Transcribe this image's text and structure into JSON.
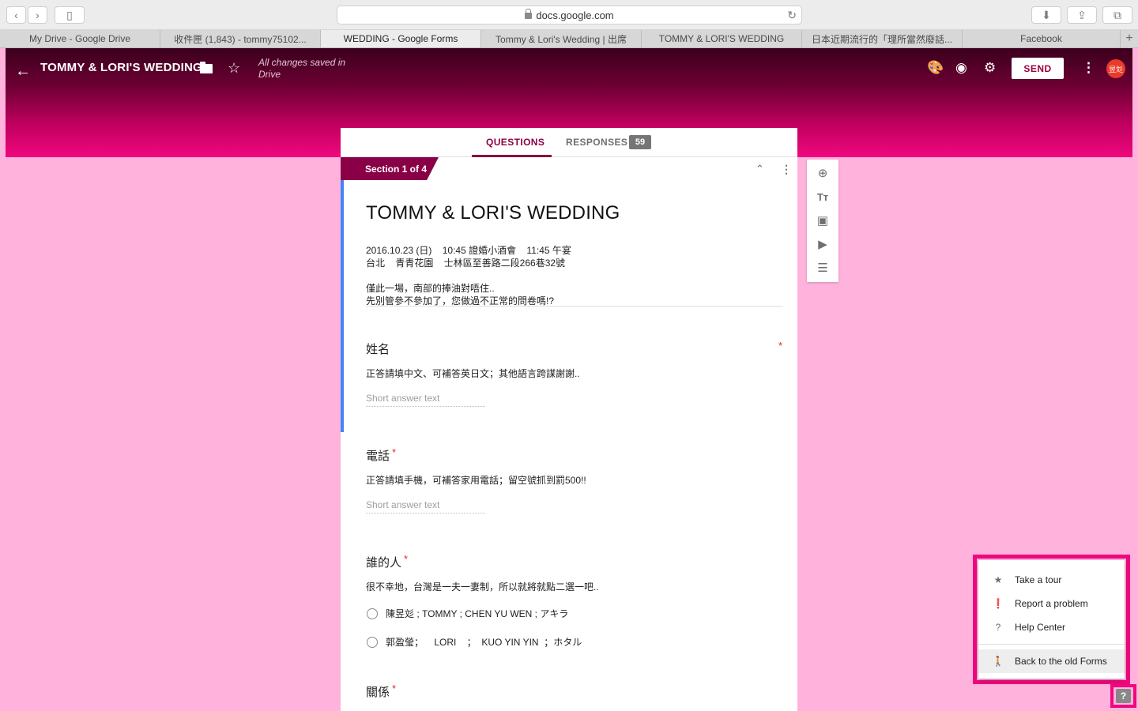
{
  "browser": {
    "url": "docs.google.com",
    "tabs": [
      {
        "label": "My Drive - Google Drive"
      },
      {
        "label": "收件匣 (1,843) - tommy75102..."
      },
      {
        "label": "WEDDING - Google Forms"
      },
      {
        "label": "Tommy & Lori's Wedding | 出席"
      },
      {
        "label": "TOMMY & LORI'S WEDDING"
      },
      {
        "label": "日本近期流行的「理所當然廢話..."
      },
      {
        "label": "Facebook"
      }
    ]
  },
  "header": {
    "title": "TOMMY & LORI'S WEDDING",
    "saved_status": "All changes saved in Drive",
    "send_label": "SEND",
    "avatar_text": "昱彣"
  },
  "form_tabs": {
    "questions_label": "QUESTIONS",
    "responses_label": "RESPONSES",
    "responses_count": "59"
  },
  "section": {
    "label": "Section 1 of 4"
  },
  "form": {
    "title": "TOMMY & LORI'S WEDDING",
    "description_lines": [
      "2016.10.23 (日)    10:45 證婚小酒會    11:45 午宴",
      "台北    青青花園    士林區至善路二段266巷32號",
      "僅此一場，南部的捧油對唔住..",
      "先別管參不參加了，您做過不正常的問卷嗎!?"
    ]
  },
  "questions": [
    {
      "title": "姓名",
      "description": "正答請填中文、可補答英日文；其他語言跨謀謝謝..",
      "placeholder": "Short answer text"
    },
    {
      "title": "電話",
      "description": "正答請填手機，可補答家用電話；留空號抓到罰500!!",
      "placeholder": "Short answer text"
    },
    {
      "title": "誰的人",
      "description": "很不幸地，台灣是一夫一妻制，所以就將就點二選一吧..",
      "options": [
        "陳昱彣 ; TOMMY ; CHEN YU WEN ; アキラ",
        "郭盈瑩；    LORI    ；  KUO YIN YIN  ；ホタル"
      ]
    },
    {
      "title": "關係"
    }
  ],
  "required_mark": "*",
  "help_menu": {
    "items": [
      {
        "label": "Take a tour",
        "icon": "star-icon"
      },
      {
        "label": "Report a problem",
        "icon": "feedback-icon"
      },
      {
        "label": "Help Center",
        "icon": "help-circle-icon"
      },
      {
        "label": "Back to the old Forms",
        "icon": "walk-back-icon"
      }
    ],
    "help_button": "?"
  },
  "colors": {
    "accent": "#8a0046",
    "header_gradient_top": "#3b001d",
    "header_gradient_bottom": "#f0087e",
    "page_background": "#ffb3dc",
    "highlight": "#f0087e",
    "focus_bar": "#4285f4"
  }
}
